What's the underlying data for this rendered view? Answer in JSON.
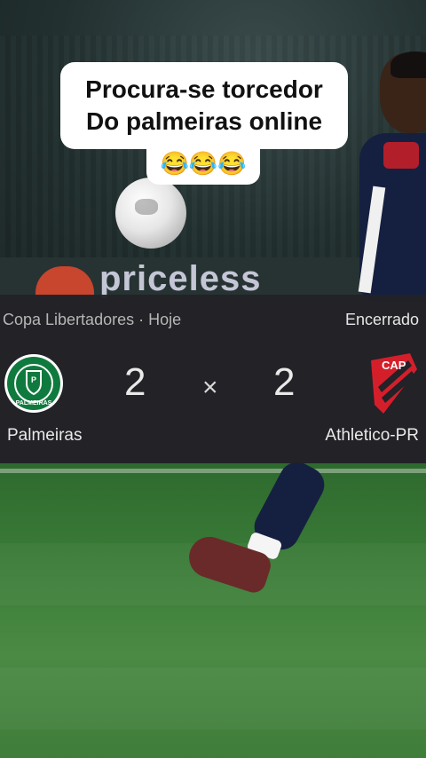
{
  "caption": {
    "line1": "Procura-se torcedor",
    "line2": "Do palmeiras online",
    "emojis": "😂😂😂"
  },
  "background": {
    "ad_text": "priceless"
  },
  "match": {
    "competition": "Copa Libertadores · Hoje",
    "status": "Encerrado",
    "separator": "×",
    "home": {
      "name": "Palmeiras",
      "score": "2",
      "crest_text": "PALMEIRAS",
      "color": "#0f7a3d"
    },
    "away": {
      "name": "Athletico-PR",
      "score": "2",
      "crest_text": "CAP",
      "color": "#d41f2b"
    }
  }
}
